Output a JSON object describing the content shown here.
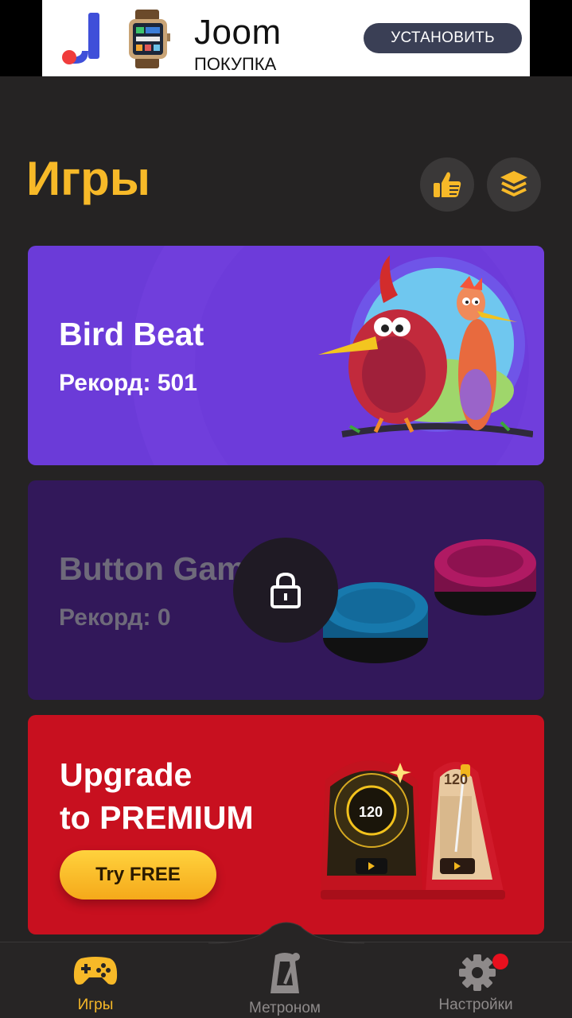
{
  "ad": {
    "brand": "Joom",
    "subtitle": "ПОКУПКА",
    "install_label": "УСТАНОВИТЬ"
  },
  "header": {
    "title": "Игры"
  },
  "games": [
    {
      "title": "Bird Beat",
      "record": "Рекорд: 501",
      "locked": false
    },
    {
      "title": "Button Game",
      "record": "Рекорд: 0",
      "locked": true
    }
  ],
  "premium": {
    "title_line1": "Upgrade",
    "title_line2": "to PREMIUM",
    "cta_label": "Try FREE",
    "device_bpm_left": "120",
    "device_bpm_right": "120"
  },
  "nav": {
    "games_label": "Игры",
    "metronome_label": "Метроном",
    "settings_label": "Настройки"
  },
  "colors": {
    "accent": "#f7b928",
    "background": "#252323",
    "bird_card": "#6b3bd8",
    "button_card": "#32185a",
    "premium_card": "#c8101f",
    "notification_dot": "#e8101e"
  }
}
